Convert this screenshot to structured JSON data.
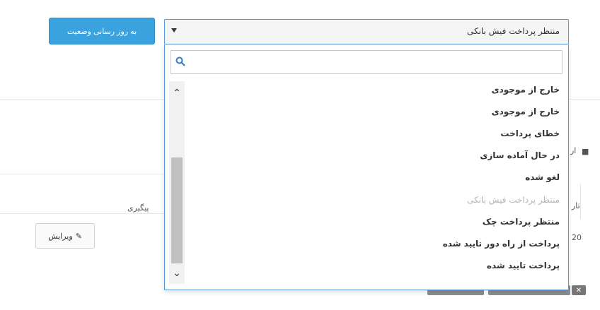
{
  "update_button": {
    "label": "به روز رسانی وضعیت"
  },
  "status_select": {
    "selected": "منتظر پرداخت فیش بانکی",
    "search_placeholder": "",
    "options": [
      {
        "label": "خارج از موجودی"
      },
      {
        "label": "خارج از موجودی"
      },
      {
        "label": "خطای پرداخت"
      },
      {
        "label": "در حال آماده سازی"
      },
      {
        "label": "لغو شده"
      },
      {
        "label": "منتظر پرداخت فیش بانکی"
      },
      {
        "label": "منتظر پرداخت چک"
      },
      {
        "label": "پرداخت از راه دور تایید شده"
      },
      {
        "label": "پرداخت تایید شده"
      }
    ]
  },
  "background": {
    "tracking_label": "پیگیری",
    "edit_button_label": "ویرایش",
    "fragment_a": "ار",
    "fragment_b": "ثار",
    "fragment_c": "20"
  },
  "colors": {
    "accent": "#3aa3df",
    "border_focus": "#5b9bd5"
  },
  "icons": [
    "chevron-down-icon",
    "search-icon",
    "chevron-up-icon",
    "pencil-icon",
    "truck-icon",
    "close-icon"
  ]
}
